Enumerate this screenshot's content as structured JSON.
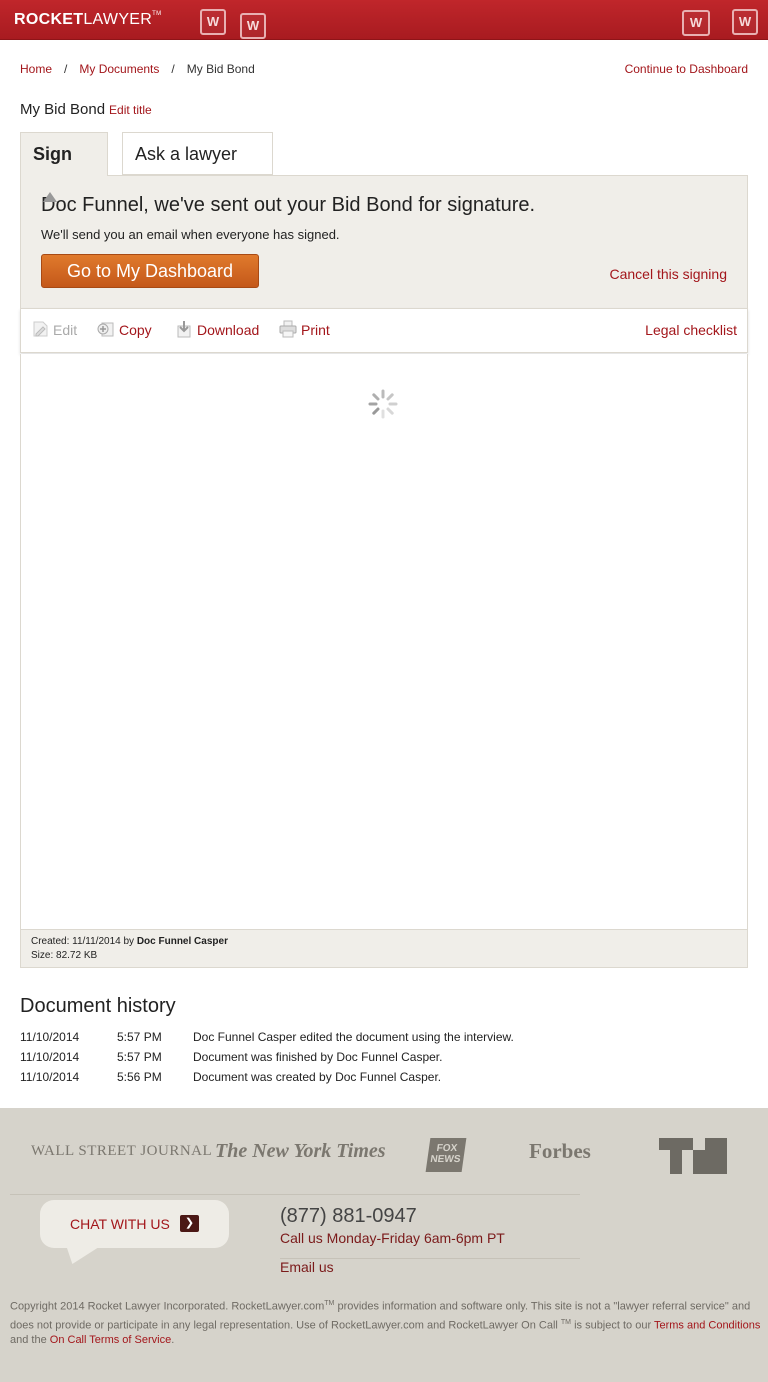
{
  "header": {
    "logo_bold": "ROCKET",
    "logo_light": "LAWYER",
    "logo_tm": "TM",
    "icon_glyph": "W"
  },
  "breadcrumb": {
    "home": "Home",
    "sep": "/",
    "my_documents": "My Documents",
    "current": "My Bid Bond",
    "continue": "Continue to Dashboard"
  },
  "document": {
    "title": "My Bid Bond",
    "edit_title": "Edit title"
  },
  "tabs": {
    "sign": "Sign",
    "ask": "Ask a lawyer"
  },
  "panel": {
    "heading": "Doc Funnel, we've sent out your Bid Bond for signature.",
    "sub": "We'll send you an email when everyone has signed.",
    "dashboard_button": "Go to My Dashboard",
    "cancel": "Cancel this signing"
  },
  "toolbar": {
    "edit": "Edit",
    "copy": "Copy",
    "download": "Download",
    "print": "Print",
    "legal": "Legal checklist"
  },
  "meta": {
    "created_label": "Created: 11/11/2014 by",
    "created_by": "Doc Funnel Casper",
    "size": "Size: 82.72 KB"
  },
  "history": {
    "title": "Document history",
    "rows": [
      {
        "date": "11/10/2014",
        "time": "5:57 PM",
        "msg": "Doc Funnel Casper edited the document using the interview."
      },
      {
        "date": "11/10/2014",
        "time": "5:57 PM",
        "msg": "Document was finished by Doc Funnel Casper."
      },
      {
        "date": "11/10/2014",
        "time": "5:56 PM",
        "msg": "Document was created by Doc Funnel Casper."
      }
    ]
  },
  "footer": {
    "press": {
      "wsj": "WALL STREET JOURNAL",
      "nyt": "The New York Times",
      "fox_line1": "FOX",
      "fox_line2": "NEWS",
      "forbes": "Forbes"
    },
    "chat": "CHAT WITH US",
    "chat_arrow": "❯",
    "phone": "(877) 881-0947",
    "hours": "Call us Monday-Friday 6am-6pm PT",
    "email": "Email us",
    "copyright_1": "Copyright 2014 Rocket Lawyer Incorporated. RocketLawyer.com",
    "tm": "TM",
    "copyright_2": " provides information and software only. This site is not a \"lawyer referral service\" and does not provide or participate in any legal representation. Use of RocketLawyer.com and RocketLawyer On Call ",
    "copyright_3": " is subject to our ",
    "terms": "Terms and Conditions",
    "and_the": " and the ",
    "oncall_terms": "On Call Terms of Service",
    "period": "."
  },
  "colors": {
    "brand_red": "#a81b20",
    "link": "#a3161b",
    "orange_button": "#d0641f"
  }
}
